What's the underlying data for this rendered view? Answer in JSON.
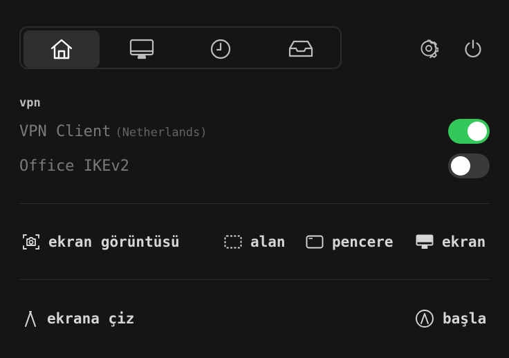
{
  "tabs": [
    {
      "id": "home",
      "icon": "home-icon",
      "active": true
    },
    {
      "id": "display",
      "icon": "monitor-icon",
      "active": false
    },
    {
      "id": "clock",
      "icon": "clock-icon",
      "active": false
    },
    {
      "id": "inbox",
      "icon": "inbox-icon",
      "active": false
    }
  ],
  "toolbar": {
    "settings_icon": "gear-icon",
    "power_icon": "power-icon"
  },
  "vpn": {
    "section_label": "vpn",
    "connections": [
      {
        "name": "VPN Client",
        "detail": "(Netherlands)",
        "enabled": true
      },
      {
        "name": "Office IKEv2",
        "detail": "",
        "enabled": false
      }
    ]
  },
  "screenshot": {
    "label": "ekran görüntüsü",
    "area_label": "alan",
    "window_label": "pencere",
    "screen_label": "ekran"
  },
  "draw": {
    "label": "ekrana çiz",
    "start_label": "başla"
  },
  "colors": {
    "background": "#151515",
    "toggle_on": "#34c759",
    "toggle_off": "#3a3a3a",
    "active_tab": "#2f2f2f"
  }
}
